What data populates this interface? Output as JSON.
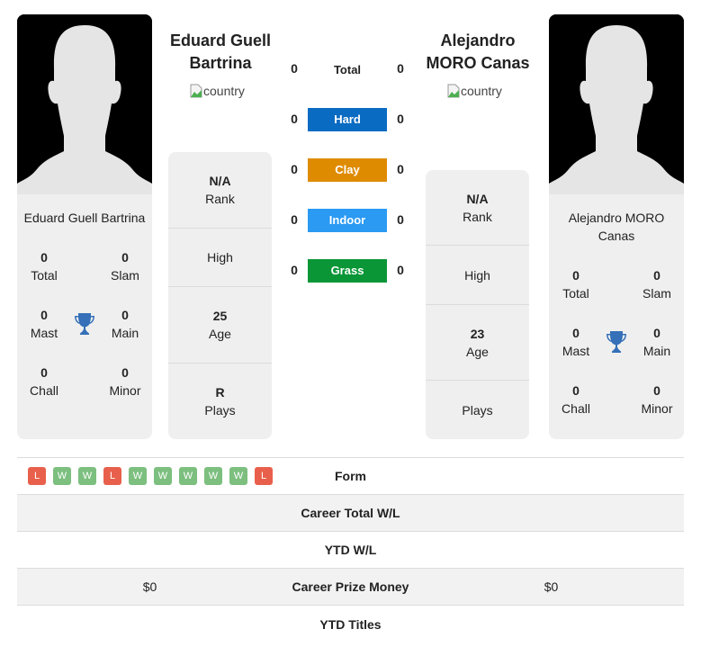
{
  "colors": {
    "hard": "#0a6bc2",
    "clay": "#df8b00",
    "indoor": "#2b9af3",
    "grass": "#0a9637",
    "win": "#7cbf7f",
    "loss": "#e8604b",
    "trophy": "#3570b8",
    "card_bg": "#efefef"
  },
  "player1": {
    "name": "Eduard Guell Bartrina",
    "name_line1": "Eduard Guell",
    "name_line2": "Bartrina",
    "country_alt": "country",
    "titles": {
      "total": {
        "value": "0",
        "label": "Total"
      },
      "slam": {
        "value": "0",
        "label": "Slam"
      },
      "mast": {
        "value": "0",
        "label": "Mast"
      },
      "main": {
        "value": "0",
        "label": "Main"
      },
      "chall": {
        "value": "0",
        "label": "Chall"
      },
      "minor": {
        "value": "0",
        "label": "Minor"
      }
    },
    "stats": {
      "rank": {
        "value": "N/A",
        "label": "Rank"
      },
      "high": {
        "value": "",
        "label": "High"
      },
      "age": {
        "value": "25",
        "label": "Age"
      },
      "plays": {
        "value": "R",
        "label": "Plays"
      }
    },
    "form": [
      "L",
      "W",
      "W",
      "L",
      "W",
      "W",
      "W",
      "W",
      "W",
      "L"
    ],
    "career_wl": "",
    "ytd_wl": "",
    "prize_money": "$0",
    "ytd_titles": ""
  },
  "player2": {
    "name": "Alejandro MORO Canas",
    "name_line1": "Alejandro",
    "name_line2": "MORO Canas",
    "country_alt": "country",
    "titles": {
      "total": {
        "value": "0",
        "label": "Total"
      },
      "slam": {
        "value": "0",
        "label": "Slam"
      },
      "mast": {
        "value": "0",
        "label": "Mast"
      },
      "main": {
        "value": "0",
        "label": "Main"
      },
      "chall": {
        "value": "0",
        "label": "Chall"
      },
      "minor": {
        "value": "0",
        "label": "Minor"
      }
    },
    "stats": {
      "rank": {
        "value": "N/A",
        "label": "Rank"
      },
      "high": {
        "value": "",
        "label": "High"
      },
      "age": {
        "value": "23",
        "label": "Age"
      },
      "plays": {
        "value": "",
        "label": "Plays"
      }
    },
    "career_wl": "",
    "ytd_wl": "",
    "prize_money": "$0",
    "ytd_titles": ""
  },
  "h2h": {
    "total": {
      "label": "Total",
      "p1": "0",
      "p2": "0"
    },
    "surfaces": [
      {
        "key": "hard",
        "label": "Hard",
        "p1": "0",
        "p2": "0"
      },
      {
        "key": "clay",
        "label": "Clay",
        "p1": "0",
        "p2": "0"
      },
      {
        "key": "indoor",
        "label": "Indoor",
        "p1": "0",
        "p2": "0"
      },
      {
        "key": "grass",
        "label": "Grass",
        "p1": "0",
        "p2": "0"
      }
    ]
  },
  "table": {
    "form_label": "Form",
    "career_wl_label": "Career Total W/L",
    "ytd_wl_label": "YTD W/L",
    "prize_label": "Career Prize Money",
    "ytd_titles_label": "YTD Titles"
  }
}
